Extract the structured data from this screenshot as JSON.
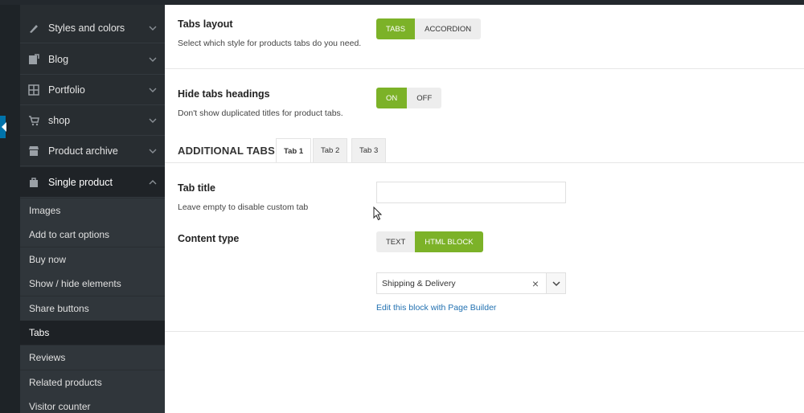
{
  "sidebar": {
    "items": [
      {
        "label": "Styles and colors",
        "icon": "brush-icon"
      },
      {
        "label": "Blog",
        "icon": "blog-icon"
      },
      {
        "label": "Portfolio",
        "icon": "grid-icon"
      },
      {
        "label": "shop",
        "icon": "cart-icon"
      },
      {
        "label": "Product archive",
        "icon": "store-icon"
      },
      {
        "label": "Single product",
        "icon": "bag-icon"
      }
    ],
    "subitems": [
      "Images",
      "Add to cart options",
      "Buy now",
      "Show / hide elements",
      "Share buttons",
      "Tabs",
      "Reviews",
      "Related products",
      "Visitor counter"
    ]
  },
  "main": {
    "tabs_layout": {
      "title": "Tabs layout",
      "desc": "Select which style for products tabs do you need.",
      "options": [
        "TABS",
        "ACCORDION"
      ],
      "selected": "TABS"
    },
    "hide_headings": {
      "title": "Hide tabs headings",
      "desc": "Don't show duplicated titles for product tabs.",
      "options": [
        "ON",
        "OFF"
      ],
      "selected": "ON"
    },
    "additional_tabs": {
      "heading": "ADDITIONAL TABS",
      "tabs": [
        "Tab 1",
        "Tab 2",
        "Tab 3"
      ],
      "active": "Tab 1"
    },
    "tab_title": {
      "title": "Tab title",
      "desc": "Leave empty to disable custom tab",
      "value": ""
    },
    "content_type": {
      "title": "Content type",
      "options": [
        "TEXT",
        "HTML BLOCK"
      ],
      "selected": "HTML BLOCK"
    },
    "block_select": {
      "value": "Shipping & Delivery",
      "clear": "×",
      "link": "Edit this block with Page Builder"
    }
  },
  "colors": {
    "accent": "#7cb228",
    "sidebar": "#282d31",
    "link": "#2271b1"
  }
}
